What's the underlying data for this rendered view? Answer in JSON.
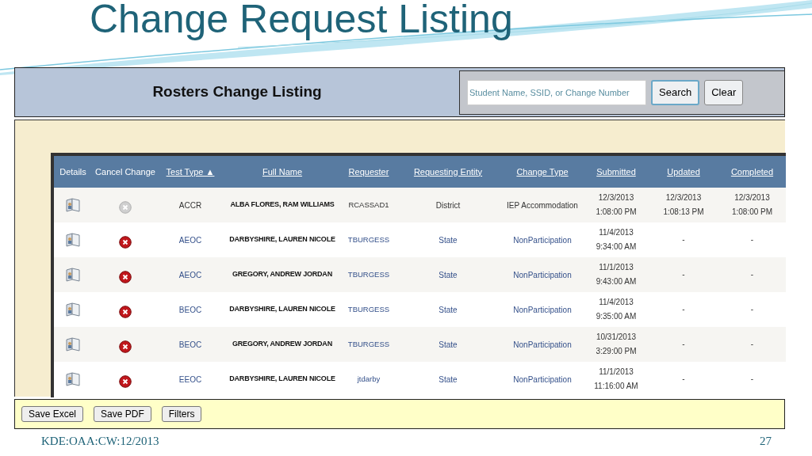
{
  "slide": {
    "title": "Change Request Listing",
    "footer": "KDE:OAA:CW:12/2013",
    "page_number": "27"
  },
  "header": {
    "title": "Rosters Change Listing",
    "search": {
      "placeholder": "Student Name, SSID, or Change Number"
    },
    "buttons": [
      "Search",
      "Clear"
    ]
  },
  "table": {
    "columns": [
      {
        "label": "Details",
        "sortable": false
      },
      {
        "label": "Cancel Change",
        "sortable": false
      },
      {
        "label": "Test Type ▲",
        "sortable": true
      },
      {
        "label": "Full Name",
        "sortable": true
      },
      {
        "label": "Requester",
        "sortable": true
      },
      {
        "label": "Requesting Entity",
        "sortable": true
      },
      {
        "label": "Change Type",
        "sortable": true
      },
      {
        "label": "Submitted",
        "sortable": true
      },
      {
        "label": "Updated",
        "sortable": true
      },
      {
        "label": "Completed",
        "sortable": true
      }
    ],
    "rows": [
      {
        "cancellable": false,
        "test_type": "ACCR",
        "full_name": "ALBA FLORES, RAM WILLIAMS",
        "requester": "RCASSAD1",
        "entity": "District",
        "change_type": "IEP Accommodation",
        "submitted": [
          "12/3/2013",
          "1:08:00 PM"
        ],
        "updated": [
          "12/3/2013",
          "1:08:13 PM"
        ],
        "completed": [
          "12/3/2013",
          "1:08:00 PM"
        ]
      },
      {
        "cancellable": true,
        "test_type": "AEOC",
        "full_name": "DARBYSHIRE, LAUREN NICOLE",
        "requester": "TBURGESS",
        "entity": "State",
        "change_type": "NonParticipation",
        "submitted": [
          "11/4/2013",
          "9:34:00 AM"
        ],
        "updated": [
          "-"
        ],
        "completed": [
          "-"
        ]
      },
      {
        "cancellable": true,
        "test_type": "AEOC",
        "full_name": "GREGORY, ANDREW JORDAN",
        "requester": "TBURGESS",
        "entity": "State",
        "change_type": "NonParticipation",
        "submitted": [
          "11/1/2013",
          "9:43:00 AM"
        ],
        "updated": [
          "-"
        ],
        "completed": [
          "-"
        ]
      },
      {
        "cancellable": true,
        "test_type": "BEOC",
        "full_name": "DARBYSHIRE, LAUREN NICOLE",
        "requester": "TBURGESS",
        "entity": "State",
        "change_type": "NonParticipation",
        "submitted": [
          "11/4/2013",
          "9:35:00 AM"
        ],
        "updated": [
          "-"
        ],
        "completed": [
          "-"
        ]
      },
      {
        "cancellable": true,
        "test_type": "BEOC",
        "full_name": "GREGORY, ANDREW JORDAN",
        "requester": "TBURGESS",
        "entity": "State",
        "change_type": "NonParticipation",
        "submitted": [
          "10/31/2013",
          "3:29:00 PM"
        ],
        "updated": [
          "-"
        ],
        "completed": [
          "-"
        ]
      },
      {
        "cancellable": true,
        "test_type": "EEOC",
        "full_name": "DARBYSHIRE, LAUREN NICOLE",
        "requester": "jtdarby",
        "entity": "State",
        "change_type": "NonParticipation",
        "submitted": [
          "11/1/2013",
          "11:16:00 AM"
        ],
        "updated": [
          "-"
        ],
        "completed": [
          "-"
        ]
      }
    ]
  },
  "toolbar": {
    "buttons": [
      "Save Excel",
      "Save PDF",
      "Filters"
    ]
  }
}
